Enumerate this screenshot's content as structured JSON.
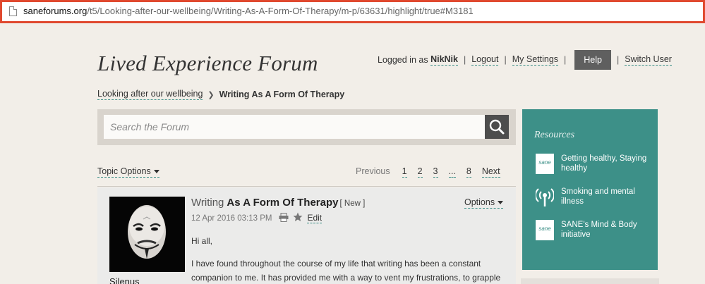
{
  "browser": {
    "url_host": "saneforums.org",
    "url_path": "/t5/Looking-after-our-wellbeing/Writing-As-A-Form-Of-Therapy/m-p/63631/highlight/true#M3181"
  },
  "header": {
    "brand": "Lived Experience Forum",
    "logged_in_prefix": "Logged in as",
    "username": "NikNik",
    "logout": "Logout",
    "settings": "My Settings",
    "help": "Help",
    "switch_user": "Switch User"
  },
  "breadcrumb": {
    "parent": "Looking after our wellbeing",
    "current": "Writing As A Form Of Therapy"
  },
  "search": {
    "placeholder": "Search the Forum"
  },
  "topic": {
    "options": "Topic Options",
    "pager": {
      "previous": "Previous",
      "pages": [
        "1",
        "2",
        "3",
        "...",
        "8"
      ],
      "next": "Next"
    }
  },
  "post": {
    "author": "Silenus",
    "title_highlight": "Writing",
    "title_rest": "As A Form Of Therapy",
    "badge": "[ New ]",
    "date": "12 Apr 2016 03:13 PM",
    "edit": "Edit",
    "options": "Options",
    "body": [
      "Hi all,",
      "I have found throughout the course of my life that  writing  has been a constant companion to me. It has provided me with a way to vent my frustrations, to grapple"
    ]
  },
  "resources": {
    "title": "Resources",
    "items": [
      {
        "icon": "sane-logo-icon",
        "label": "Getting healthy, Staying healthy"
      },
      {
        "icon": "broadcast-icon",
        "label": "Smoking and mental illness"
      },
      {
        "icon": "sane-logo-icon",
        "label": "SANE's Mind & Body initiative"
      }
    ],
    "logo_text": "sane"
  },
  "colors": {
    "teal": "#3d9088",
    "highlight_border": "#e0492f",
    "background": "#f2eee8"
  }
}
